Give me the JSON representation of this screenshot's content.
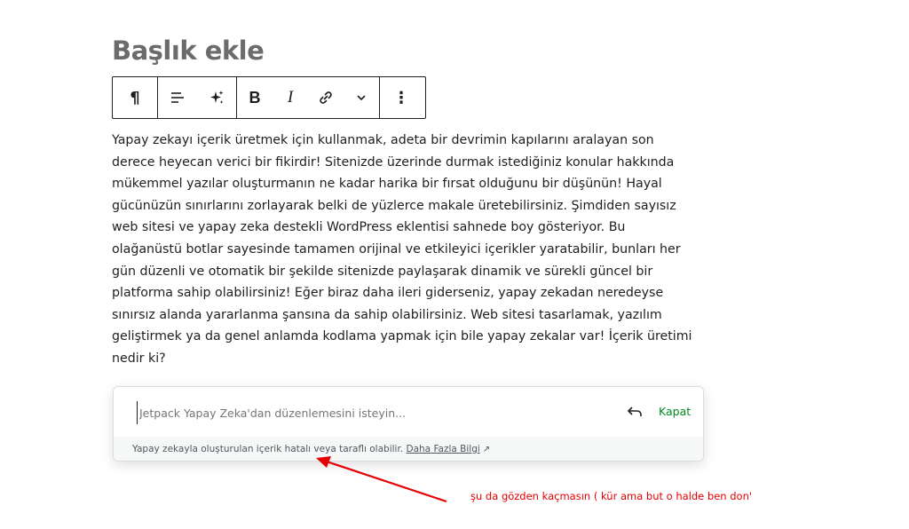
{
  "page": {
    "title": "Başlık ekle"
  },
  "toolbar": {
    "paragraph_icon": "¶",
    "bold": "B",
    "italic": "I",
    "more_icon": "⋮"
  },
  "content": {
    "paragraph": "Yapay zekayı içerik üretmek için kullanmak, adeta bir devrimin kapılarını aralayan son derece heyecan verici bir fikirdir! Sitenizde üzerinde durmak istediğiniz konular hakkında mükemmel yazılar oluşturmanın ne kadar harika bir fırsat olduğunu bir düşünün! Hayal gücünüzün sınırlarını zorlayarak belki de yüzlerce makale üretebilirsiniz. Şimdiden sayısız web sitesi ve yapay zeka destekli WordPress eklentisi sahnede boy gösteriyor. Bu olağanüstü botlar sayesinde tamamen orijinal ve etkileyici içerikler yaratabilir, bunları her gün düzenli ve otomatik bir şekilde sitenizde paylaşarak dinamik ve sürekli güncel bir platforma sahip olabilirsiniz! Eğer biraz daha ileri giderseniz, yapay zekadan neredeyse sınırsız alanda yararlanma şansına da sahip olabilirsiniz. Web sitesi tasarlamak, yazılım geliştirmek ya da genel anlamda kodlama yapmak için bile yapay zekalar var! İçerik üretimi nedir ki?"
  },
  "ai_assistant": {
    "placeholder": "Jetpack Yapay Zeka'dan düzenlemesini isteyin...",
    "close_label": "Kapat",
    "disclaimer": "Yapay zekayla oluşturulan içerik hatalı veya taraflı olabilir.",
    "learn_more": "Daha Fazla Bilgi",
    "external_icon": "↗"
  },
  "annotation": {
    "text": "şu da gözden kaçmasın ( kür ama but o halde ben don'",
    "color": "#e60000"
  },
  "colors": {
    "accent": "#008a20",
    "title": "#6b6b6b"
  },
  "icons": [
    "paragraph-icon",
    "align-icon",
    "sparkle-icon",
    "link-icon",
    "chevron-down-icon",
    "more-vertical-icon",
    "undo-icon",
    "external-link-icon"
  ]
}
